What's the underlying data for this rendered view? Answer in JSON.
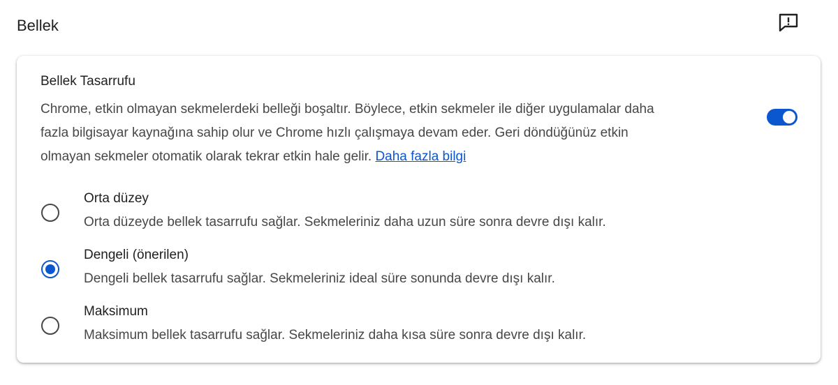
{
  "header": {
    "title": "Bellek",
    "feedback_icon": "feedback-icon"
  },
  "memory_saver": {
    "title": "Bellek Tasarrufu",
    "description_lines": [
      "Chrome, etkin olmayan sekmelerdeki belleği boşaltır. Böylece, etkin sekmeler ile diğer uygulamalar daha",
      "fazla bilgisayar kaynağına sahip olur ve Chrome hızlı çalışmaya devam eder. Geri döndüğünüz etkin",
      "olmayan sekmeler otomatik olarak tekrar etkin hale gelir. "
    ],
    "learn_more": "Daha fazla bilgi",
    "enabled": true,
    "accent_color": "#0b57d0"
  },
  "options": [
    {
      "label": "Orta düzey",
      "description": "Orta düzeyde bellek tasarrufu sağlar. Sekmeleriniz daha uzun süre sonra devre dışı kalır.",
      "selected": false
    },
    {
      "label": "Dengeli (önerilen)",
      "description": "Dengeli bellek tasarrufu sağlar. Sekmeleriniz ideal süre sonunda devre dışı kalır.",
      "selected": true
    },
    {
      "label": "Maksimum",
      "description": "Maksimum bellek tasarrufu sağlar. Sekmeleriniz daha kısa süre sonra devre dışı kalır.",
      "selected": false
    }
  ]
}
